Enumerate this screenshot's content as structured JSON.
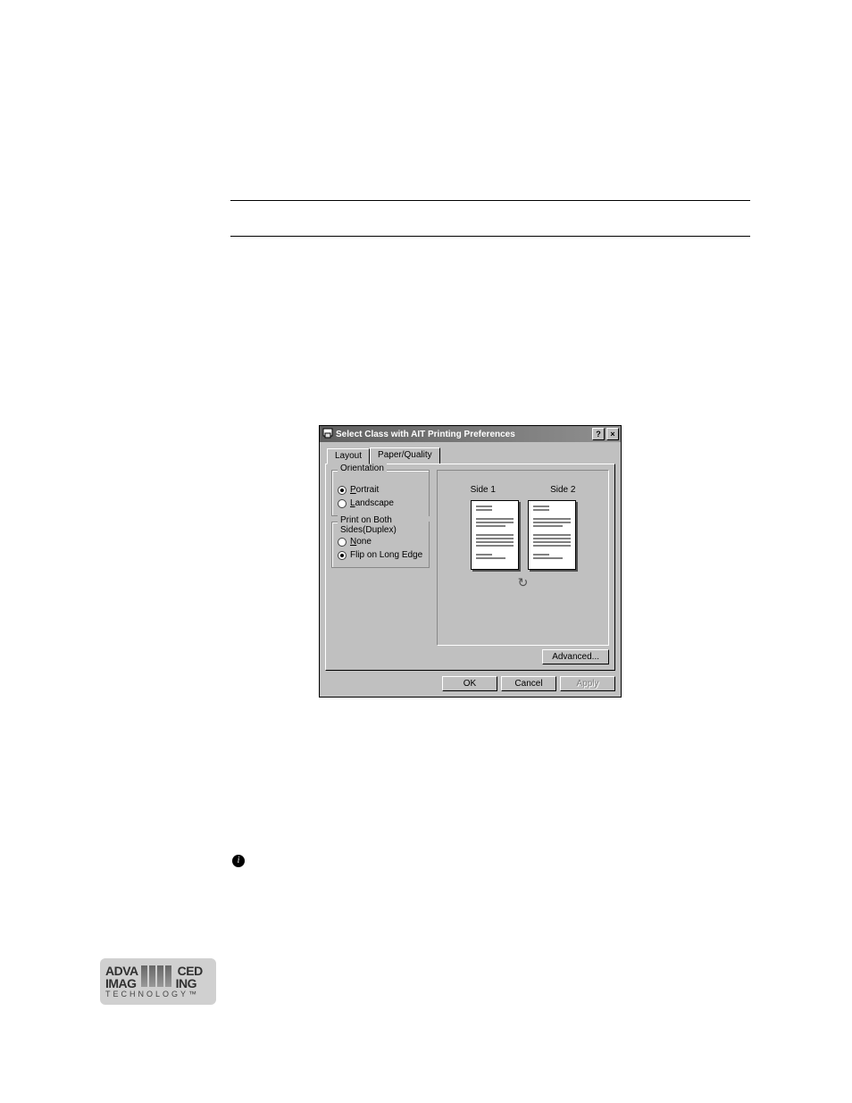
{
  "dialog": {
    "title": "Select Class with AIT Printing Preferences",
    "helpGlyph": "?",
    "closeGlyph": "×",
    "tabs": [
      {
        "label": "Layout",
        "active": true
      },
      {
        "label": "Paper/Quality",
        "active": false
      }
    ],
    "orientation": {
      "legend": "Orientation",
      "options": [
        {
          "label": "Portrait",
          "checked": true
        },
        {
          "label": "Landscape",
          "checked": false
        }
      ]
    },
    "duplex": {
      "legend": "Print on Both Sides(Duplex)",
      "options": [
        {
          "label": "None",
          "checked": false
        },
        {
          "label": "Flip on Long Edge",
          "checked": true
        }
      ]
    },
    "preview": {
      "side1": "Side 1",
      "side2": "Side 2",
      "flipGlyph": "↻"
    },
    "advanced": "Advanced...",
    "buttons": {
      "ok": "OK",
      "cancel": "Cancel",
      "apply": "Apply"
    }
  },
  "info_glyph": "i",
  "logo": {
    "row1a": "ADVA",
    "row1b": "CED",
    "row2a": "IMAG",
    "row2b": "ING",
    "row3": "TECHNOLOGY™"
  }
}
